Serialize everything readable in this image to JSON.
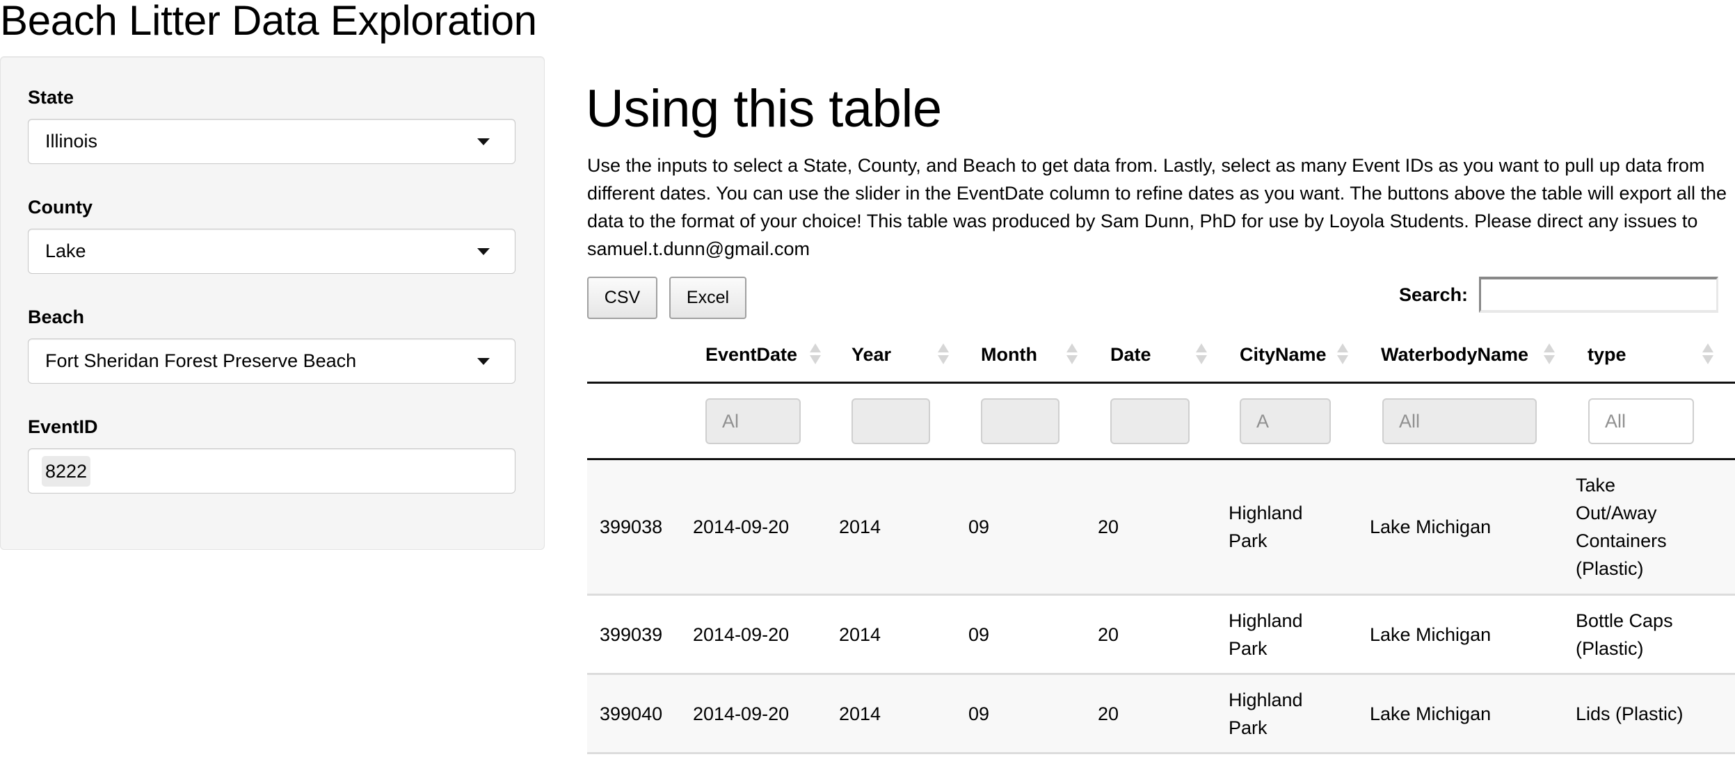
{
  "app_title": "Beach Litter Data Exploration",
  "sidebar": {
    "state": {
      "label": "State",
      "value": "Illinois"
    },
    "county": {
      "label": "County",
      "value": "Lake"
    },
    "beach": {
      "label": "Beach",
      "value": "Fort Sheridan Forest Preserve Beach"
    },
    "event_id": {
      "label": "EventID",
      "selected": [
        "8222"
      ]
    }
  },
  "main": {
    "heading": "Using this table",
    "intro": "Use the inputs to select a State, County, and Beach to get data from. Lastly, select as many Event IDs as you want to pull up data from different dates. You can use the slider in the EventDate column to refine dates as you want. The buttons above the table will export all the data to the format of your choice! This table was produced by Sam Dunn, PhD for use by Loyola Students. Please direct any issues to samuel.t.dunn@gmail.com",
    "buttons": {
      "csv": "CSV",
      "excel": "Excel"
    },
    "search": {
      "label": "Search:",
      "value": ""
    },
    "table": {
      "columns": [
        "",
        "EventDate",
        "Year",
        "Month",
        "Date",
        "CityName",
        "WaterbodyName",
        "type"
      ],
      "filters": {
        "EventDate": "Al",
        "Year": "",
        "Month": "",
        "Date": "",
        "CityName": "A",
        "WaterbodyName": "All",
        "type": "All"
      },
      "sort_icon": "sort-both-icon",
      "rows": [
        {
          "id": "399038",
          "EventDate": "2014-09-20",
          "Year": "2014",
          "Month": "09",
          "Date": "20",
          "CityName": "Highland Park",
          "WaterbodyName": "Lake Michigan",
          "type": "Take Out/Away Containers (Plastic)"
        },
        {
          "id": "399039",
          "EventDate": "2014-09-20",
          "Year": "2014",
          "Month": "09",
          "Date": "20",
          "CityName": "Highland Park",
          "WaterbodyName": "Lake Michigan",
          "type": "Bottle Caps (Plastic)"
        },
        {
          "id": "399040",
          "EventDate": "2014-09-20",
          "Year": "2014",
          "Month": "09",
          "Date": "20",
          "CityName": "Highland Park",
          "WaterbodyName": "Lake Michigan",
          "type": "Lids (Plastic)"
        }
      ]
    }
  },
  "colors": {
    "well_bg": "#f5f5f5",
    "row_stripe": "#f8f8f8",
    "filter_disabled_bg": "#ebebeb",
    "sort_icon": "#d6d6d6"
  }
}
